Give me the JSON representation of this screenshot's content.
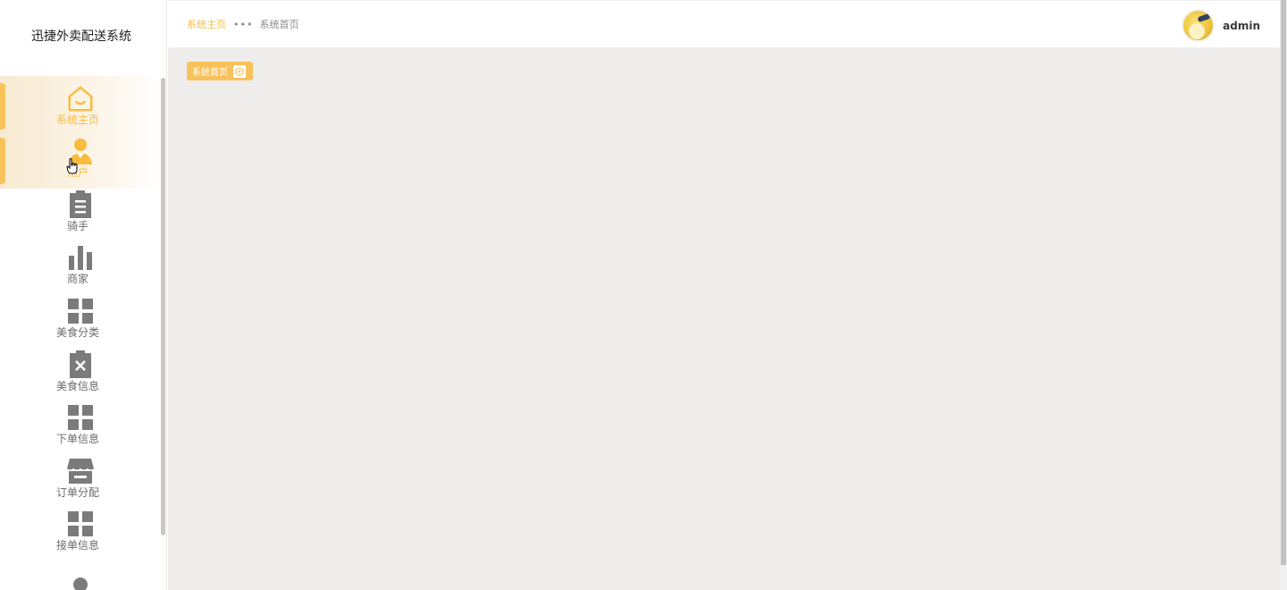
{
  "app": {
    "title": "迅捷外卖配送系统"
  },
  "header": {
    "breadcrumb_home": "系统主页",
    "breadcrumb_sep": "•••",
    "breadcrumb_current": "系统首页",
    "username": "admin"
  },
  "tabs": [
    {
      "label": "系统首页",
      "icon": "home-shield-icon",
      "active": true
    }
  ],
  "sidebar": {
    "items": [
      {
        "label": "系统主页",
        "icon": "home-icon",
        "active": true
      },
      {
        "label": "用户",
        "icon": "user-icon",
        "active": true
      },
      {
        "label": "骑手",
        "icon": "clipboard-icon",
        "active": false
      },
      {
        "label": "商家",
        "icon": "bar-chart-icon",
        "active": false
      },
      {
        "label": "美食分类",
        "icon": "grid-icon",
        "active": false
      },
      {
        "label": "美食信息",
        "icon": "clipboard-x-icon",
        "active": false
      },
      {
        "label": "下单信息",
        "icon": "grid-icon",
        "active": false
      },
      {
        "label": "订单分配",
        "icon": "shop-icon",
        "active": false
      },
      {
        "label": "接单信息",
        "icon": "grid-icon",
        "active": false
      },
      {
        "label": "",
        "icon": "person-icon",
        "active": false
      }
    ]
  },
  "colors": {
    "accent": "#f9bc3f",
    "icon_gray": "#7b7b7b",
    "content_bg": "#eeedec"
  }
}
